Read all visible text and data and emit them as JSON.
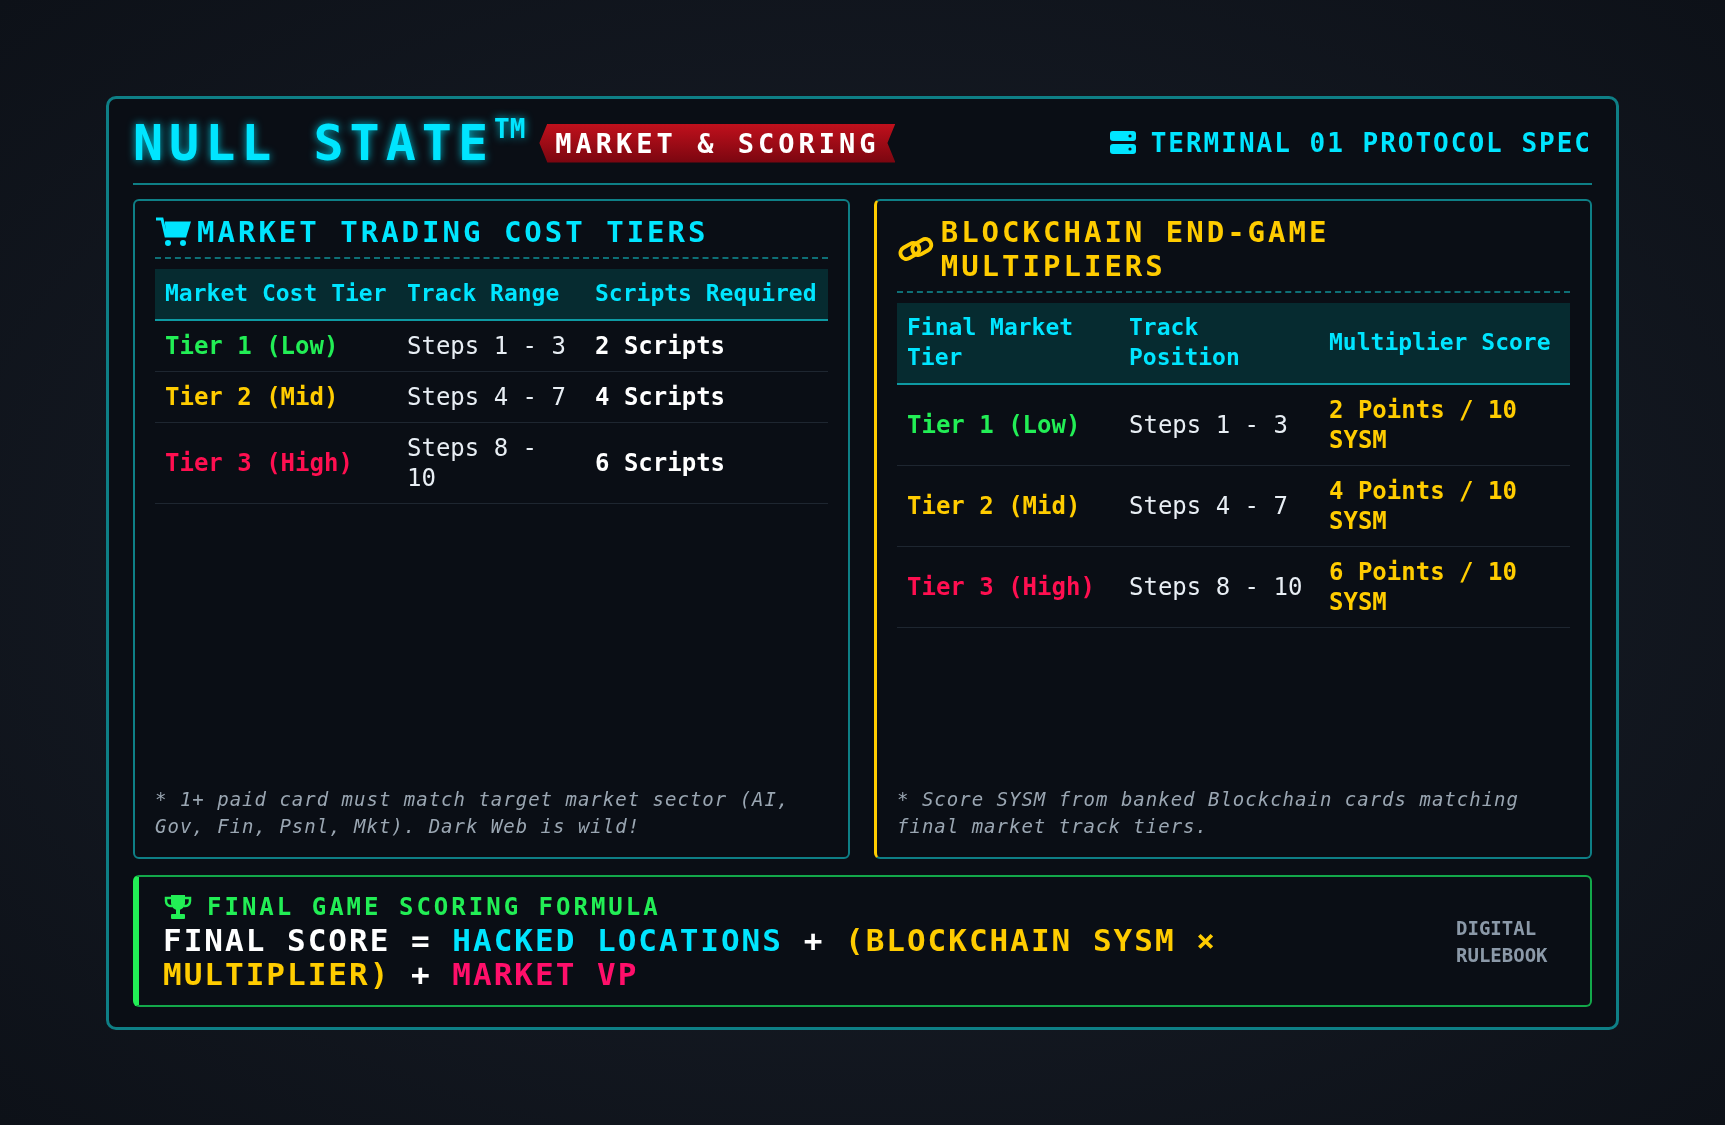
{
  "header": {
    "logo": "NULL STATE",
    "trademark": "TM",
    "banner": "MARKET & SCORING",
    "terminal_label": "TERMINAL 01 PROTOCOL SPEC"
  },
  "panels": [
    {
      "kind": "market",
      "title": "MARKET TRADING COST TIERS",
      "columns": [
        "Market Cost Tier",
        "Track Range",
        "Scripts Required"
      ],
      "rows": [
        {
          "tier": "Tier 1 (Low)",
          "color": "#22ee55",
          "range": "Steps 1 - 3",
          "value": "2 Scripts"
        },
        {
          "tier": "Tier 2 (Mid)",
          "color": "#ffcc00",
          "range": "Steps 4 - 7",
          "value": "4 Scripts"
        },
        {
          "tier": "Tier 3 (High)",
          "color": "#ff0f50",
          "range": "Steps 8 - 10",
          "value": "6 Scripts"
        }
      ],
      "note": "* 1+ paid card must match target market sector (AI, Gov, Fin, Psnl, Mkt). Dark Web is wild!"
    },
    {
      "kind": "blockchain",
      "title": "BLOCKCHAIN END-GAME MULTIPLIERS",
      "columns": [
        "Final Market Tier",
        "Track Position",
        "Multiplier Score"
      ],
      "rows": [
        {
          "tier": "Tier 1 (Low)",
          "color": "#22ee55",
          "range": "Steps 1 - 3",
          "value": "2 Points / 10 SYSM"
        },
        {
          "tier": "Tier 2 (Mid)",
          "color": "#ffcc00",
          "range": "Steps 4 - 7",
          "value": "4 Points / 10 SYSM"
        },
        {
          "tier": "Tier 3 (High)",
          "color": "#ff0f50",
          "range": "Steps 8 - 10",
          "value": "6 Points / 10 SYSM"
        }
      ],
      "note": "* Score SYSM from banked Blockchain cards matching final market track tiers."
    }
  ],
  "formula": {
    "title": "FINAL GAME SCORING FORMULA",
    "parts": [
      {
        "text": "FINAL SCORE",
        "color": "#ffffff"
      },
      {
        "text": "=",
        "color": "#ffffff"
      },
      {
        "text": "HACKED LOCATIONS",
        "color": "#00e5ff"
      },
      {
        "text": "+",
        "color": "#ffffff"
      },
      {
        "text": "(BLOCKCHAIN SYSM × MULTIPLIER)",
        "color": "#ffcc00"
      },
      {
        "text": "+",
        "color": "#ffffff"
      },
      {
        "text": "MARKET VP",
        "color": "#ff0f6a"
      }
    ],
    "badge": "DIGITAL RULEBOOK"
  }
}
